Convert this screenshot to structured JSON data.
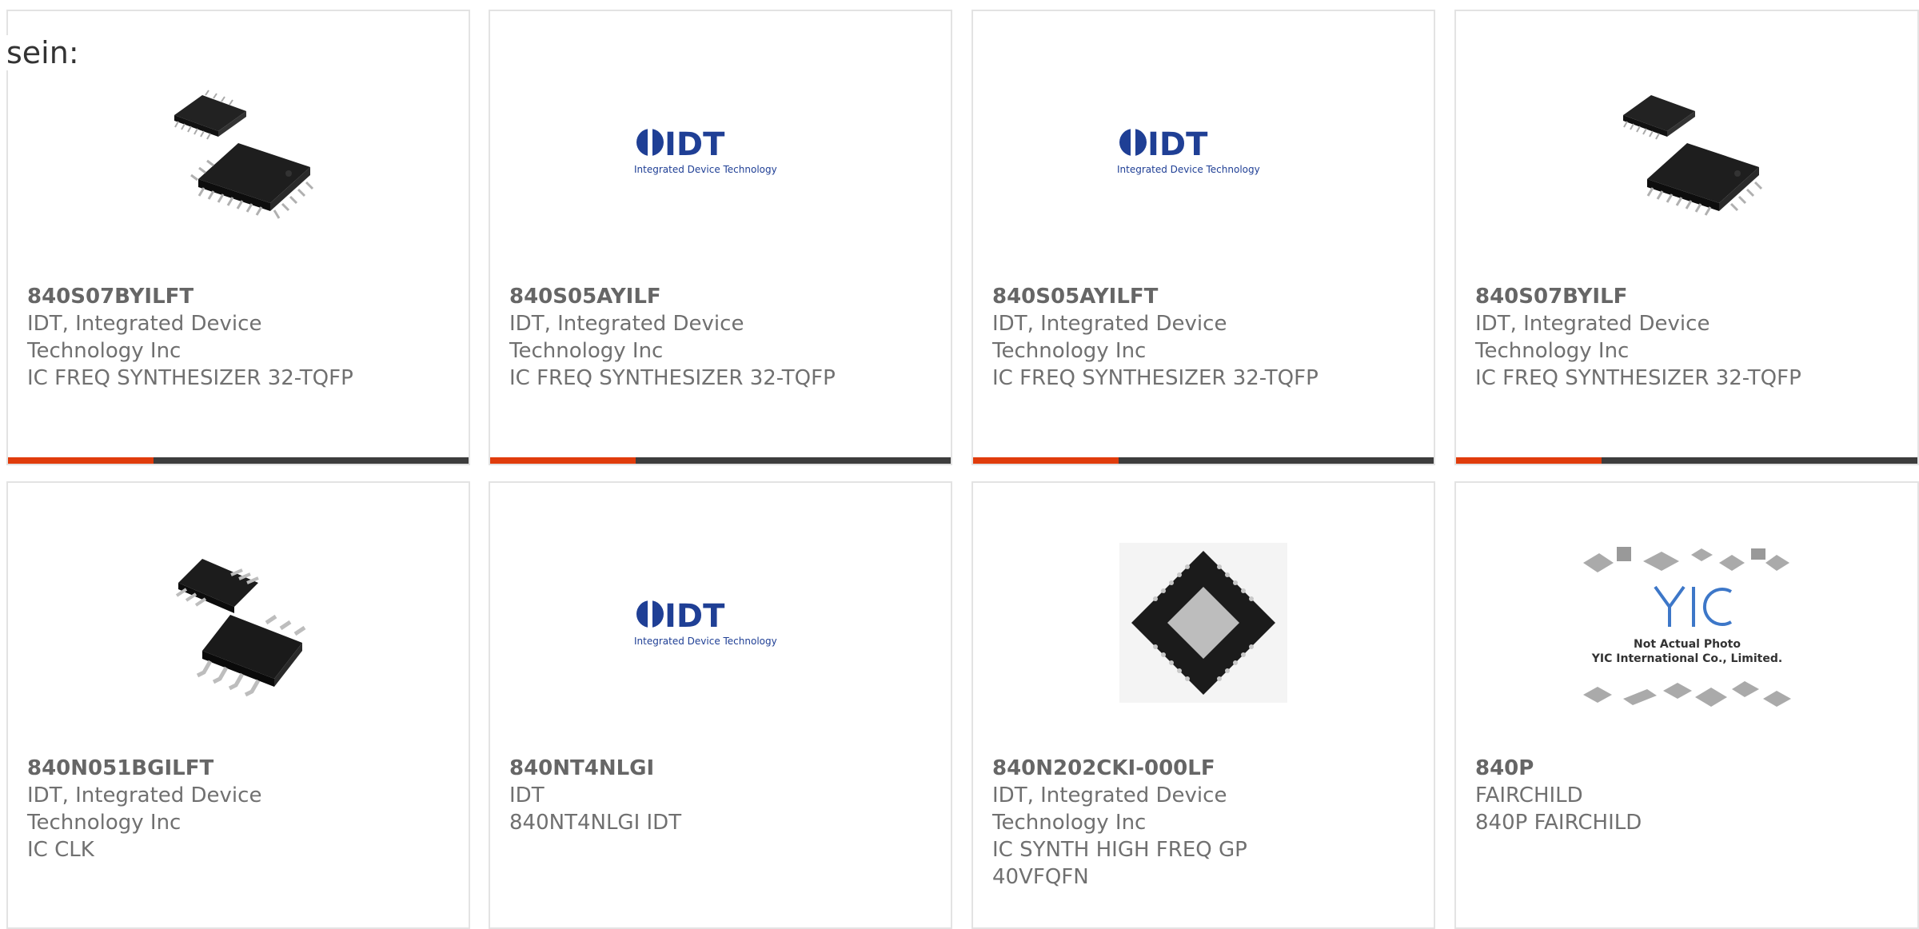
{
  "page": {
    "corner_label": "sein:"
  },
  "colors": {
    "accent": "#e03c0c",
    "bar": "#3d3d3d",
    "border": "#e3e3e3",
    "idt_blue": "#1f3f95"
  },
  "products": [
    {
      "part": "840S07BYILFT",
      "lines": [
        "IDT, Integrated Device",
        "Technology Inc",
        "IC FREQ SYNTHESIZER 32-TQFP"
      ],
      "image": "tqfp-chip-image"
    },
    {
      "part": "840S05AYILF",
      "lines": [
        "IDT, Integrated Device",
        "Technology Inc",
        "IC FREQ SYNTHESIZER 32-TQFP"
      ],
      "image": "idt-logo-image"
    },
    {
      "part": "840S05AYILFT",
      "lines": [
        "IDT, Integrated Device",
        "Technology Inc",
        "IC FREQ SYNTHESIZER 32-TQFP"
      ],
      "image": "idt-logo-image"
    },
    {
      "part": "840S07BYILF",
      "lines": [
        "IDT, Integrated Device",
        "Technology Inc",
        "IC FREQ SYNTHESIZER 32-TQFP"
      ],
      "image": "tqfp-chip-image"
    },
    {
      "part": "840N051BGILFT",
      "lines": [
        "IDT, Integrated Device",
        "Technology Inc",
        "IC CLK"
      ],
      "image": "tssop-chip-image"
    },
    {
      "part": "840NT4NLGI",
      "lines": [
        "IDT",
        "840NT4NLGI IDT"
      ],
      "image": "idt-logo-image"
    },
    {
      "part": "840N202CKI-000LF",
      "lines": [
        "IDT, Integrated Device",
        "Technology Inc",
        "IC SYNTH HIGH FREQ GP",
        "40VFQFN"
      ],
      "image": "vfqfn-chip-image"
    },
    {
      "part": "840P",
      "lines": [
        "FAIRCHILD",
        "840P FAIRCHILD"
      ],
      "image": "yic-placeholder-image"
    }
  ],
  "logos": {
    "idt_mark": "IDT",
    "idt_sub": "Integrated Device Technology",
    "yic_mark": "YIC",
    "yic_line1": "Not Actual Photo",
    "yic_line2": "YIC International Co., Limited."
  }
}
